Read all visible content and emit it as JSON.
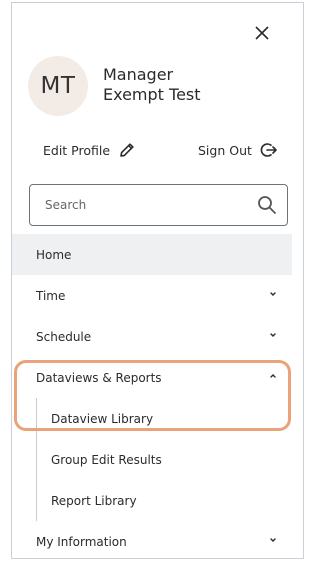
{
  "profile": {
    "initials": "MT",
    "name_line1": "Manager",
    "name_line2": "Exempt Test",
    "edit_label": "Edit Profile",
    "signout_label": "Sign Out"
  },
  "search": {
    "placeholder": "Search",
    "value": ""
  },
  "nav": {
    "home": "Home",
    "time": "Time",
    "schedule": "Schedule",
    "dataviews": "Dataviews & Reports",
    "dataviews_children": [
      "Dataview Library",
      "Group Edit Results",
      "Report Library"
    ],
    "my_information": "My Information"
  },
  "colors": {
    "highlight": "#e9a27a",
    "active_bg": "#eef0f2",
    "avatar_bg": "#f3ece6"
  }
}
